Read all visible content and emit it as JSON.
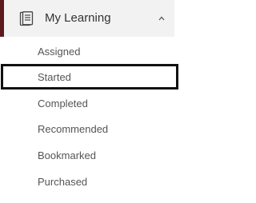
{
  "section": {
    "title": "My Learning",
    "icon": "document-icon",
    "expanded": true,
    "chevron_icon": "chevron-up-icon",
    "accent_color": "#5c1a1f"
  },
  "menu": {
    "items": [
      {
        "label": "Assigned",
        "selected": false
      },
      {
        "label": "Started",
        "selected": true
      },
      {
        "label": "Completed",
        "selected": false
      },
      {
        "label": "Recommended",
        "selected": false
      },
      {
        "label": "Bookmarked",
        "selected": false
      },
      {
        "label": "Purchased",
        "selected": false
      }
    ]
  }
}
